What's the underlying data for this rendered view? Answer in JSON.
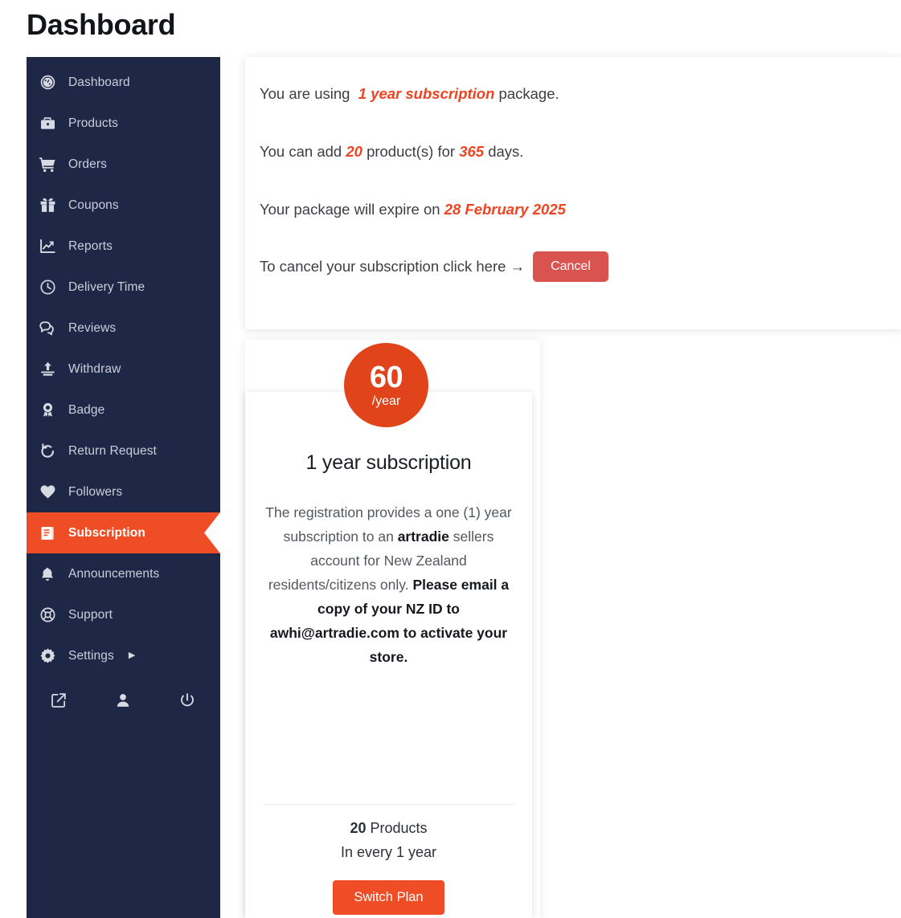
{
  "header": {
    "title": "Dashboard"
  },
  "sidebar": {
    "items": [
      {
        "label": "Dashboard",
        "icon": "speedometer-icon",
        "active": false
      },
      {
        "label": "Products",
        "icon": "briefcase-icon",
        "active": false
      },
      {
        "label": "Orders",
        "icon": "shopping-cart-icon",
        "active": false
      },
      {
        "label": "Coupons",
        "icon": "gift-icon",
        "active": false
      },
      {
        "label": "Reports",
        "icon": "chart-line-icon",
        "active": false
      },
      {
        "label": "Delivery Time",
        "icon": "clock-icon",
        "active": false
      },
      {
        "label": "Reviews",
        "icon": "comments-icon",
        "active": false
      },
      {
        "label": "Withdraw",
        "icon": "upload-icon",
        "active": false
      },
      {
        "label": "Badge",
        "icon": "award-icon",
        "active": false
      },
      {
        "label": "Return Request",
        "icon": "undo-icon",
        "active": false
      },
      {
        "label": "Followers",
        "icon": "heart-icon",
        "active": false
      },
      {
        "label": "Subscription",
        "icon": "book-icon",
        "active": true
      },
      {
        "label": "Announcements",
        "icon": "bell-icon",
        "active": false
      },
      {
        "label": "Support",
        "icon": "lifebuoy-icon",
        "active": false
      },
      {
        "label": "Settings",
        "icon": "gear-icon",
        "active": false,
        "caret": "▶"
      }
    ],
    "bottom_icons": [
      {
        "name": "external-link-icon"
      },
      {
        "name": "user-icon"
      },
      {
        "name": "power-icon"
      }
    ]
  },
  "info_panel": {
    "line1_pre": "You are using",
    "line1_highlight": "1 year subscription",
    "line1_post": "package.",
    "line2_pre": "You can add",
    "line2_products": "20",
    "line2_mid": "product(s) for",
    "line2_days": "365",
    "line2_post": "days.",
    "line3_pre": "Your package will expire on",
    "line3_date": "28 February 2025",
    "cancel_text": "To cancel your subscription click here →",
    "cancel_button": "Cancel"
  },
  "plan_card": {
    "price_amount": "60",
    "price_period": "/year",
    "title": "1 year subscription",
    "desc_part1": "The registration provides a one (1) year subscription to an ",
    "desc_brand": "artradie",
    "desc_part2": " sellers account for New Zealand residents/citizens only. ",
    "desc_bold_note": "Please email a copy of your NZ ID to awhi@artradie.com to activate your store.",
    "products_count": "20",
    "products_label": " Products",
    "period_note": "In every 1 year",
    "switch_button": "Switch Plan"
  },
  "colors": {
    "sidebar_bg": "#1e2746",
    "accent_orange": "#ef4d26",
    "price_bubble": "#e1431b",
    "cancel_red": "#d9534f",
    "highlight_text": "#ef4423"
  }
}
